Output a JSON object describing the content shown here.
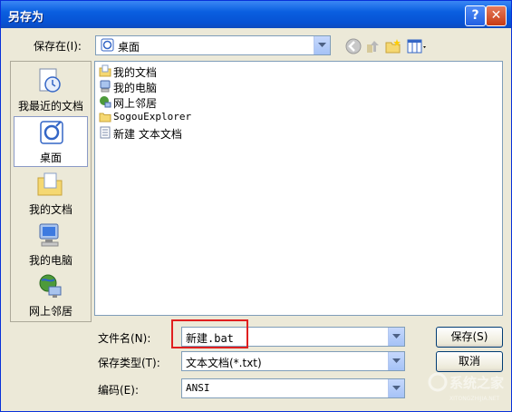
{
  "window": {
    "title": "另存为"
  },
  "header": {
    "save_in_label": "保存在(I):",
    "location": "桌面"
  },
  "places": [
    {
      "label": "我最近的文档",
      "icon": "recent-documents-icon"
    },
    {
      "label": "桌面",
      "icon": "desktop-icon",
      "selected": true
    },
    {
      "label": "我的文档",
      "icon": "my-documents-icon"
    },
    {
      "label": "我的电脑",
      "icon": "my-computer-icon"
    },
    {
      "label": "网上邻居",
      "icon": "network-places-icon"
    }
  ],
  "files": [
    {
      "name": "我的文档",
      "icon": "my-documents-icon"
    },
    {
      "name": "我的电脑",
      "icon": "my-computer-icon"
    },
    {
      "name": "网上邻居",
      "icon": "network-places-icon"
    },
    {
      "name": "SogouExplorer",
      "icon": "folder-icon"
    },
    {
      "name": "新建 文本文档",
      "icon": "text-file-icon"
    }
  ],
  "form": {
    "filename_label": "文件名(N):",
    "filename_value": "新建.bat",
    "filetype_label": "保存类型(T):",
    "filetype_value": "文本文档(*.txt)",
    "encoding_label": "编码(E):",
    "encoding_value": "ANSI",
    "save_button": "保存(S)",
    "cancel_button": "取消"
  },
  "watermark": {
    "text": "系统之家",
    "sub": "XITONGZHIJIA.NET"
  }
}
